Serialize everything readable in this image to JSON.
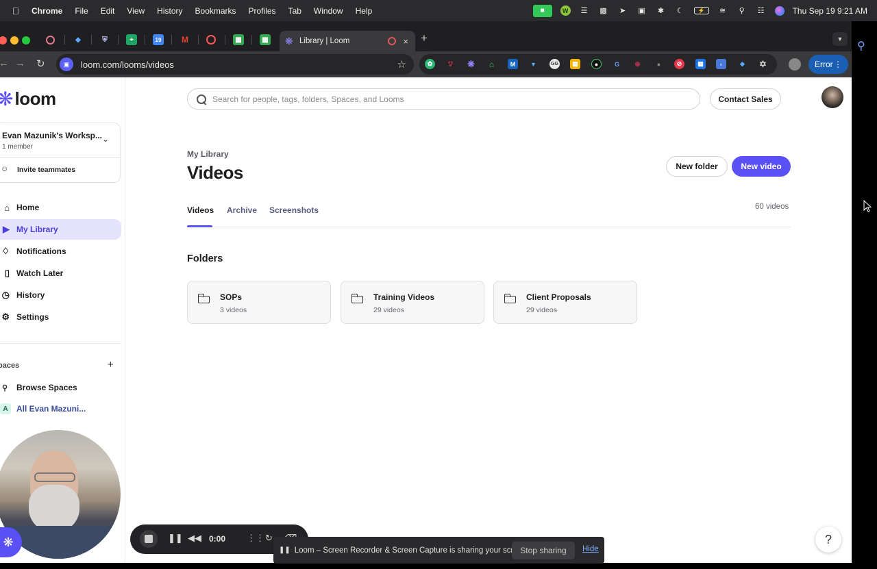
{
  "menubar": {
    "app": "Chrome",
    "items": [
      "File",
      "Edit",
      "View",
      "History",
      "Bookmarks",
      "Profiles",
      "Tab",
      "Window",
      "Help"
    ],
    "clock": "Thu Sep 19  9:21 AM",
    "cam_glyph": "■",
    "w_glyph": "W",
    "batt_glyph": "⚡"
  },
  "browser": {
    "active_tab_title": "Library | Loom",
    "url": "loom.com/looms/videos",
    "error_label": "Error",
    "new_tab_glyph": "+",
    "close_glyph": "×"
  },
  "sidebar": {
    "brand": "loom",
    "workspace_name": "Evan Mazunik's Worksp...",
    "workspace_members": "1 member",
    "invite_label": "Invite teammates",
    "nav": [
      {
        "label": "Home",
        "icon": "home-icon"
      },
      {
        "label": "My Library",
        "icon": "library-icon",
        "active": true
      },
      {
        "label": "Notifications",
        "icon": "bell-icon"
      },
      {
        "label": "Watch Later",
        "icon": "bookmark-icon"
      },
      {
        "label": "History",
        "icon": "clock-icon"
      },
      {
        "label": "Settings",
        "icon": "gear-icon"
      }
    ],
    "spaces_header": "paces",
    "browse_spaces": "Browse Spaces",
    "all_space": "All Evan Mazuni...",
    "all_space_letter": "A"
  },
  "header": {
    "search_placeholder": "Search for people, tags, folders, Spaces, and Looms",
    "contact_sales": "Contact Sales"
  },
  "main": {
    "breadcrumb": "My Library",
    "title": "Videos",
    "new_folder": "New folder",
    "new_video": "New video",
    "tabs": [
      {
        "label": "Videos",
        "active": true
      },
      {
        "label": "Archive"
      },
      {
        "label": "Screenshots"
      }
    ],
    "video_count": "60 videos",
    "folders_header": "Folders",
    "folders": [
      {
        "name": "SOPs",
        "count": "3 videos"
      },
      {
        "name": "Training Videos",
        "count": "29 videos"
      },
      {
        "name": "Client Proposals",
        "count": "29 videos"
      }
    ],
    "help": "?"
  },
  "recording": {
    "time": "0:00"
  },
  "sharing_bar": {
    "message": "Loom – Screen Recorder & Screen Capture is sharing your screen.",
    "stop_label": "Stop sharing",
    "hide_label": "Hide"
  },
  "colors": {
    "brand": "#5b50f5",
    "active_nav_bg": "#e6e3ff"
  }
}
